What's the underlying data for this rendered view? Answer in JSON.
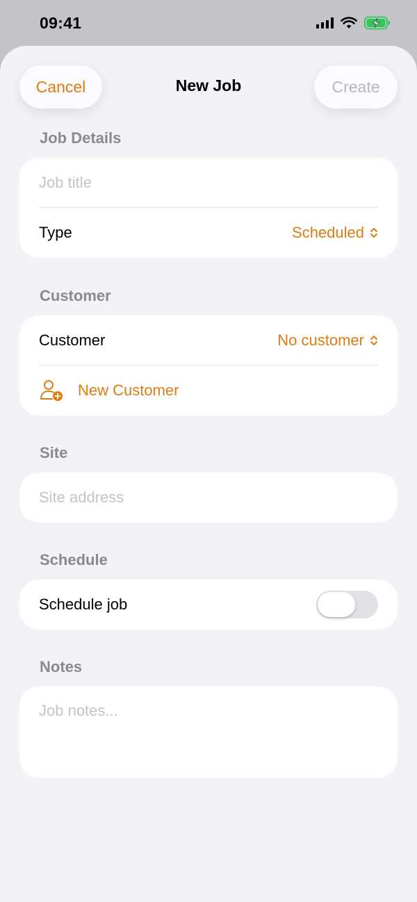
{
  "status_bar": {
    "time": "09:41"
  },
  "nav": {
    "cancel_label": "Cancel",
    "title": "New Job",
    "create_label": "Create"
  },
  "job_details": {
    "header": "Job Details",
    "title_placeholder": "Job title",
    "type_label": "Type",
    "type_value": "Scheduled"
  },
  "customer": {
    "header": "Customer",
    "label": "Customer",
    "value": "No customer",
    "new_label": "New Customer"
  },
  "site": {
    "header": "Site",
    "address_placeholder": "Site address"
  },
  "schedule": {
    "header": "Schedule",
    "label": "Schedule job",
    "enabled": false
  },
  "notes": {
    "header": "Notes",
    "placeholder": "Job notes..."
  },
  "colors": {
    "accent": "#e07b12",
    "background": "#f2f2f7",
    "card": "#ffffff",
    "battery": "#34c759"
  },
  "icons": [
    "signal-icon",
    "wifi-icon",
    "battery-charging-icon",
    "chevron-up-down-icon",
    "person-add-icon"
  ]
}
